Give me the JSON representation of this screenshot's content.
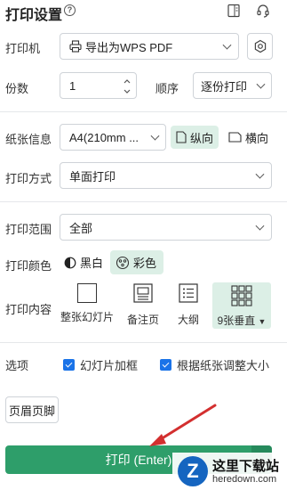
{
  "header": {
    "title": "打印设置",
    "help_icon": "?"
  },
  "printer": {
    "label": "打印机",
    "value": "导出为WPS PDF"
  },
  "copies": {
    "label": "份数",
    "value": "1"
  },
  "order": {
    "label": "顺序",
    "value": "逐份打印"
  },
  "paper": {
    "label": "纸张信息",
    "value": "A4(210mm ...",
    "portrait": "纵向",
    "landscape": "横向"
  },
  "mode": {
    "label": "打印方式",
    "value": "单面打印"
  },
  "range": {
    "label": "打印范围",
    "value": "全部"
  },
  "color": {
    "label": "打印颜色",
    "bw": "黑白",
    "color": "彩色"
  },
  "content": {
    "label": "打印内容",
    "options": [
      "整张幻灯片",
      "备注页",
      "大纲",
      "9张垂直"
    ]
  },
  "options": {
    "label": "选项",
    "frame": "幻灯片加框",
    "fit": "根据纸张调整大小"
  },
  "header_footer": {
    "label": "页眉页脚"
  },
  "print_button": {
    "label": "打印 (Enter)"
  },
  "watermark": {
    "name": "这里下载站",
    "url": "heredown.com"
  },
  "colors": {
    "accent": "#2e9e6a",
    "active_bg": "#dcefe6",
    "checkbox": "#1a73e8",
    "arrow": "#d32f2f"
  }
}
